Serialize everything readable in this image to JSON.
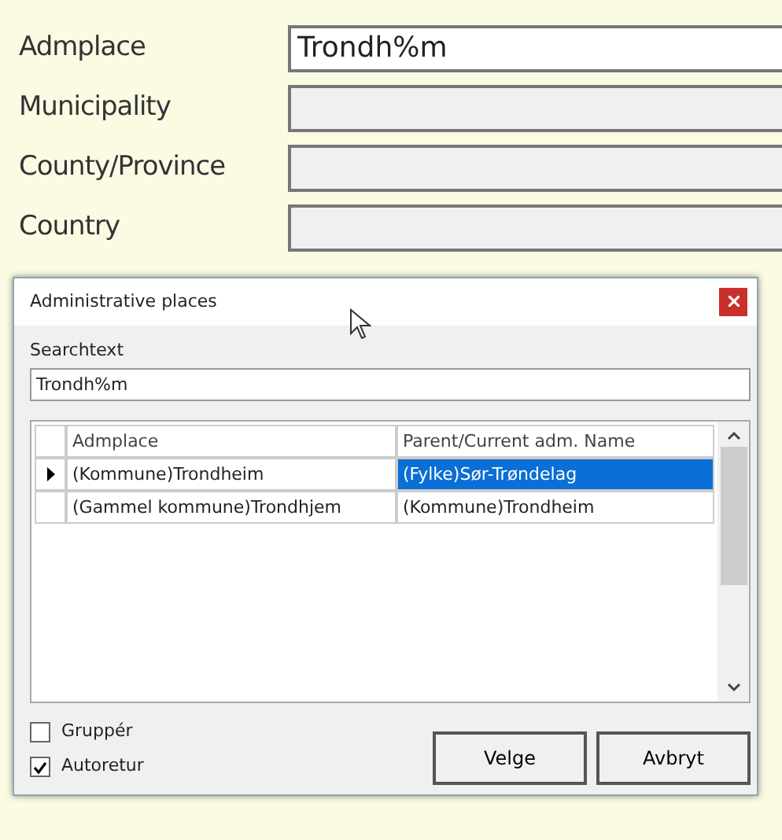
{
  "form": {
    "fields": [
      {
        "label": "Admplace",
        "value": "Trondh%m",
        "disabled": false
      },
      {
        "label": "Municipality",
        "disabled": true
      },
      {
        "label": "County/Province",
        "disabled": true
      },
      {
        "label": "Country",
        "disabled": true
      }
    ]
  },
  "dialog": {
    "title": "Administrative places",
    "search": {
      "label": "Searchtext",
      "value": "Trondh%m"
    },
    "table": {
      "columns": [
        "Admplace",
        "Parent/Current adm. Name"
      ],
      "rows": [
        {
          "current": true,
          "cells": [
            {
              "text": "(Kommune)Trondheim",
              "selected": false
            },
            {
              "text": "(Fylke)Sør-Trøndelag",
              "selected": true
            }
          ]
        },
        {
          "current": false,
          "cells": [
            {
              "text": "(Gammel kommune)Trondhjem",
              "selected": false
            },
            {
              "text": "(Kommune)Trondheim",
              "selected": false
            }
          ]
        }
      ]
    },
    "options": [
      {
        "label": "Gruppér",
        "checked": false
      },
      {
        "label": "Autoretur",
        "checked": true
      }
    ],
    "buttons": [
      "Velge",
      "Avbryt"
    ]
  }
}
